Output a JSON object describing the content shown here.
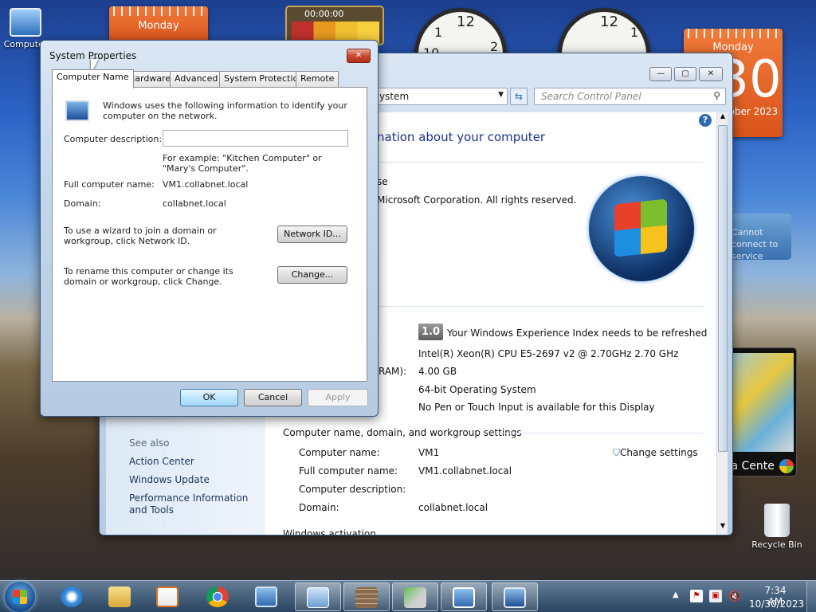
{
  "desktop": {
    "computer_icon_label": "Computer",
    "recycle_bin_label": "Recycle Bin",
    "calendar_left_day": "Monday",
    "calendar_right_day": "Monday",
    "calendar_right_date": "30",
    "calendar_right_month_year": "October 2023",
    "stopwatch_time": "00:00:00",
    "media_gadget_label": "Media Center",
    "weather_gadget_text": "Cannot connect to service"
  },
  "system_properties": {
    "title": "System Properties",
    "tabs": [
      "Computer Name",
      "Hardware",
      "Advanced",
      "System Protection",
      "Remote"
    ],
    "intro": "Windows uses the following information to identify your computer on the network.",
    "description_label": "Computer description:",
    "description_value": "",
    "example_text": "For example: \"Kitchen Computer\" or \"Mary's Computer\".",
    "full_name_label": "Full computer name:",
    "full_name_value": "VM1.collabnet.local",
    "domain_label": "Domain:",
    "domain_value": "collabnet.local",
    "wizard_text": "To use a wizard to join a domain or workgroup, click Network ID.",
    "network_id_button": "Network ID...",
    "rename_text": "To rename this computer or change its domain or workgroup, click Change.",
    "change_button": "Change...",
    "ok_button": "OK",
    "cancel_button": "Cancel",
    "apply_button": "Apply"
  },
  "control_panel": {
    "address_text": "ystem",
    "search_placeholder": "Search Control Panel",
    "heading": "nation about your computer",
    "edition_fragment": "se",
    "copyright": "Microsoft Corporation.  All rights reserved.",
    "rating_score": "1.0",
    "rating_link": "Your Windows Experience Index needs to be refreshed",
    "processor": "Intel(R) Xeon(R) CPU E5-2697 v2 @ 2.70GHz   2.70 GHz",
    "ram_label_fragment": "RAM):",
    "ram_value": "4.00 GB",
    "system_type": "64-bit Operating System",
    "pen_touch": "No Pen or Touch Input is available for this Display",
    "section_title": "Computer name, domain, and workgroup settings",
    "computer_name_label": "Computer name:",
    "computer_name_value": "VM1",
    "full_name_label": "Full computer name:",
    "full_name_value": "VM1.collabnet.local",
    "description_label": "Computer description:",
    "domain_label": "Domain:",
    "domain_value": "collabnet.local",
    "change_settings": "Change settings",
    "see_also": "See also",
    "see_also_links": [
      "Action Center",
      "Windows Update",
      "Performance Information and Tools"
    ],
    "cut_off_text": "Windows activation"
  },
  "taskbar": {
    "time": "7:34 AM",
    "date": "10/30/2023",
    "items": [
      "internet-explorer",
      "windows-explorer",
      "media-player",
      "chrome",
      "remote-desktop",
      "control-panel",
      "firewall",
      "network-tool",
      "system-properties",
      "computer-management"
    ]
  }
}
